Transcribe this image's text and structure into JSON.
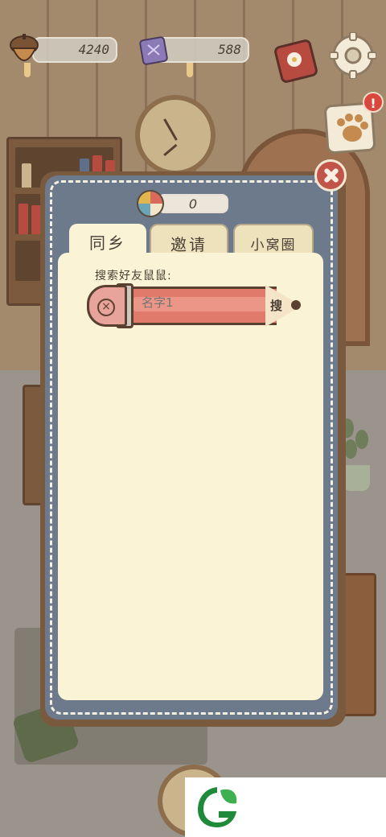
{
  "hud": {
    "acorns": "4240",
    "gems": "588"
  },
  "icons": {
    "acorn": "acorn-icon",
    "gem": "gem-icon",
    "book": "book-icon",
    "settings": "gear-icon",
    "paw": "paw-icon",
    "alert": "!",
    "close": "close-icon",
    "ball": "ball-icon"
  },
  "dialog": {
    "ball_count": "0",
    "tabs": [
      {
        "label": "同乡",
        "active": true
      },
      {
        "label": "邀请",
        "active": false
      },
      {
        "label": "小窝圈",
        "active": false
      }
    ],
    "search_label": "搜索好友鼠鼠:",
    "search_placeholder": "名字1",
    "search_button": "搜"
  },
  "colors": {
    "dialog_frame": "#6d7a8c",
    "content_bg": "#fbf3d5",
    "pencil_body": "#e07a6a",
    "close_red": "#c2554a",
    "alert_red": "#d9473d"
  }
}
